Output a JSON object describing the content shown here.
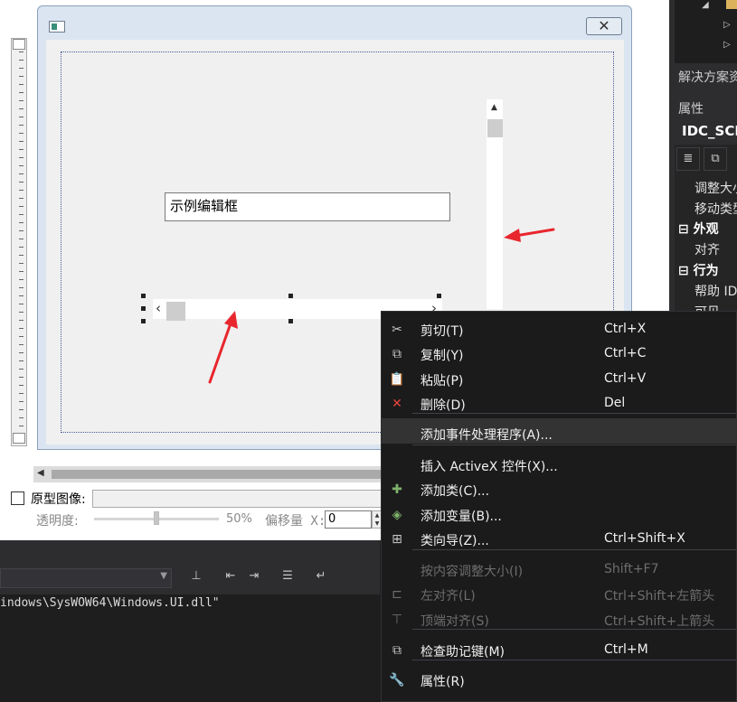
{
  "designer": {
    "edit_box_text": "示例编辑框",
    "close_glyph": "✕"
  },
  "bottom_bar": {
    "prototype_label": "原型图像:",
    "opacity_label": "透明度:",
    "opacity_value": "50%",
    "opacity_fraction": 0.5,
    "offset_label": "偏移量 X:",
    "offset_value": "0"
  },
  "output": {
    "text": "indows\\SysWOW64\\Windows.UI.dll\""
  },
  "right_panel": {
    "solution_tab": "解决方案资",
    "properties_title": "属性",
    "object_id": "IDC_SCR",
    "rows": [
      {
        "kind": "row",
        "label": "调整大小"
      },
      {
        "kind": "row",
        "label": "移动类型"
      },
      {
        "kind": "cat",
        "label": "外观"
      },
      {
        "kind": "row",
        "label": "对齐"
      },
      {
        "kind": "cat",
        "label": "行为"
      },
      {
        "kind": "row",
        "label": "帮助 ID"
      },
      {
        "kind": "row",
        "label": "可见"
      }
    ]
  },
  "context_menu": {
    "items": [
      {
        "icon": "scissors-icon",
        "glyph": "✂",
        "label": "剪切(T)",
        "shortcut": "Ctrl+X",
        "disabled": false
      },
      {
        "icon": "copy-icon",
        "glyph": "⧉",
        "label": "复制(Y)",
        "shortcut": "Ctrl+C",
        "disabled": false
      },
      {
        "icon": "paste-icon",
        "glyph": "📋",
        "label": "粘贴(P)",
        "shortcut": "Ctrl+V",
        "disabled": false
      },
      {
        "icon": "delete-icon",
        "glyph": "✕",
        "label": "删除(D)",
        "shortcut": "Del",
        "disabled": false
      },
      {
        "icon": "",
        "glyph": "",
        "label": "添加事件处理程序(A)...",
        "shortcut": "",
        "disabled": false,
        "highlighted": true
      },
      {
        "icon": "",
        "glyph": "",
        "label": "插入 ActiveX 控件(X)...",
        "shortcut": "",
        "disabled": false
      },
      {
        "icon": "add-class-icon",
        "glyph": "✚",
        "label": "添加类(C)...",
        "shortcut": "",
        "disabled": false
      },
      {
        "icon": "add-variable-icon",
        "glyph": "◈",
        "label": "添加变量(B)...",
        "shortcut": "",
        "disabled": false
      },
      {
        "icon": "class-wizard-icon",
        "glyph": "⊞",
        "label": "类向导(Z)...",
        "shortcut": "Ctrl+Shift+X",
        "disabled": false
      },
      {
        "icon": "",
        "glyph": "",
        "label": "按内容调整大小(I)",
        "shortcut": "Shift+F7",
        "disabled": true
      },
      {
        "icon": "align-left-icon",
        "glyph": "⊏",
        "label": "左对齐(L)",
        "shortcut": "Ctrl+Shift+左箭头",
        "disabled": true
      },
      {
        "icon": "align-top-icon",
        "glyph": "⊤",
        "label": "顶端对齐(S)",
        "shortcut": "Ctrl+Shift+上箭头",
        "disabled": true
      },
      {
        "icon": "check-mnemonics-icon",
        "glyph": "⧉",
        "label": "检查助记键(M)",
        "shortcut": "Ctrl+M",
        "disabled": false
      },
      {
        "icon": "wrench-icon",
        "glyph": "🔧",
        "label": "属性(R)",
        "shortcut": "",
        "disabled": false
      }
    ]
  },
  "colors": {
    "arrow": "#e8262d",
    "delete_icon": "#e8453c"
  }
}
